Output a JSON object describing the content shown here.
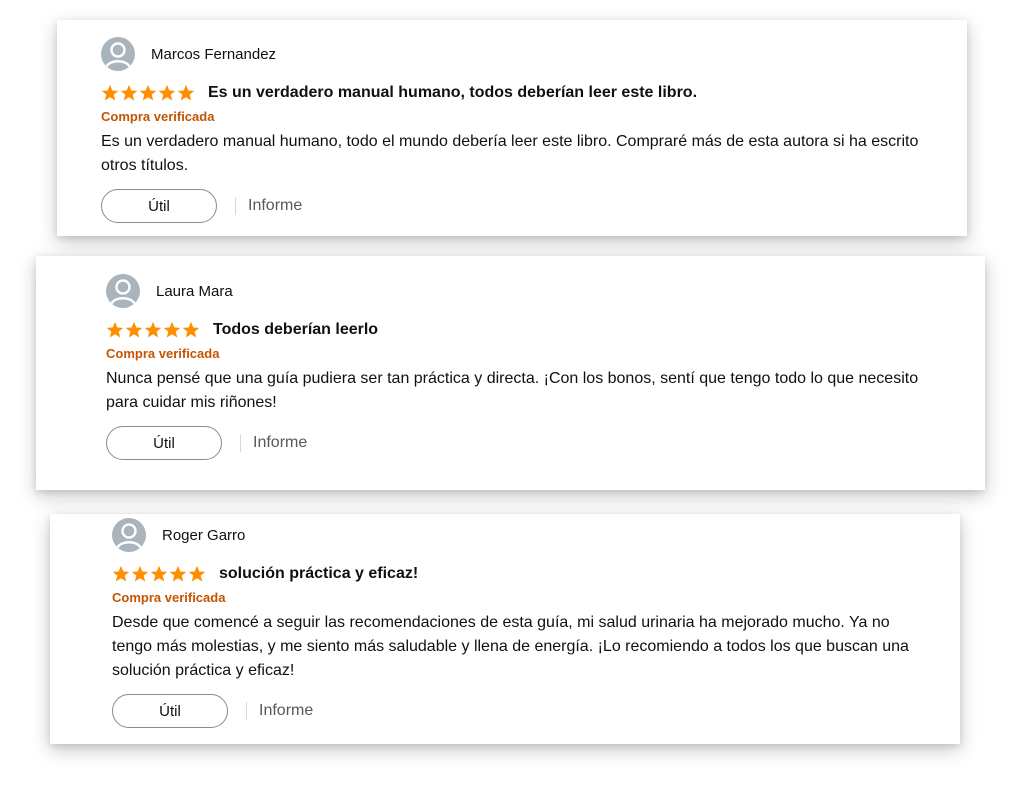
{
  "colors": {
    "star": "#ff8f00",
    "verified": "#c45500",
    "avatar": "#a9b4bc"
  },
  "icons": {
    "avatar": "user-avatar-icon",
    "star": "star-icon"
  },
  "reviews": [
    {
      "user": "Marcos Fernandez",
      "rating": 5,
      "title": "Es un verdadero manual humano, todos deberían leer este libro.",
      "verified": "Compra verificada",
      "body": "Es un verdadero manual humano, todo el mundo debería leer este libro. Compraré más de esta autora si ha escrito otros títulos.",
      "useful_label": "Útil",
      "report_label": "Informe"
    },
    {
      "user": "Laura Mara",
      "rating": 5,
      "title": "Todos deberían leerlo",
      "verified": "Compra verificada",
      "body": "Nunca pensé que una guía pudiera ser tan práctica y directa. ¡Con los bonos, sentí que tengo todo lo que necesito para cuidar mis riñones!",
      "useful_label": "Útil",
      "report_label": "Informe"
    },
    {
      "user": "Roger Garro",
      "rating": 5,
      "title": "solución práctica y eficaz!",
      "verified": "Compra verificada",
      "body": "Desde que comencé a seguir las recomendaciones de esta guía, mi salud urinaria ha mejorado mucho. Ya no tengo más molestias, y me siento más saludable y llena de energía. ¡Lo recomiendo a todos los que buscan una solución práctica y eficaz!",
      "useful_label": "Útil",
      "report_label": "Informe"
    }
  ]
}
